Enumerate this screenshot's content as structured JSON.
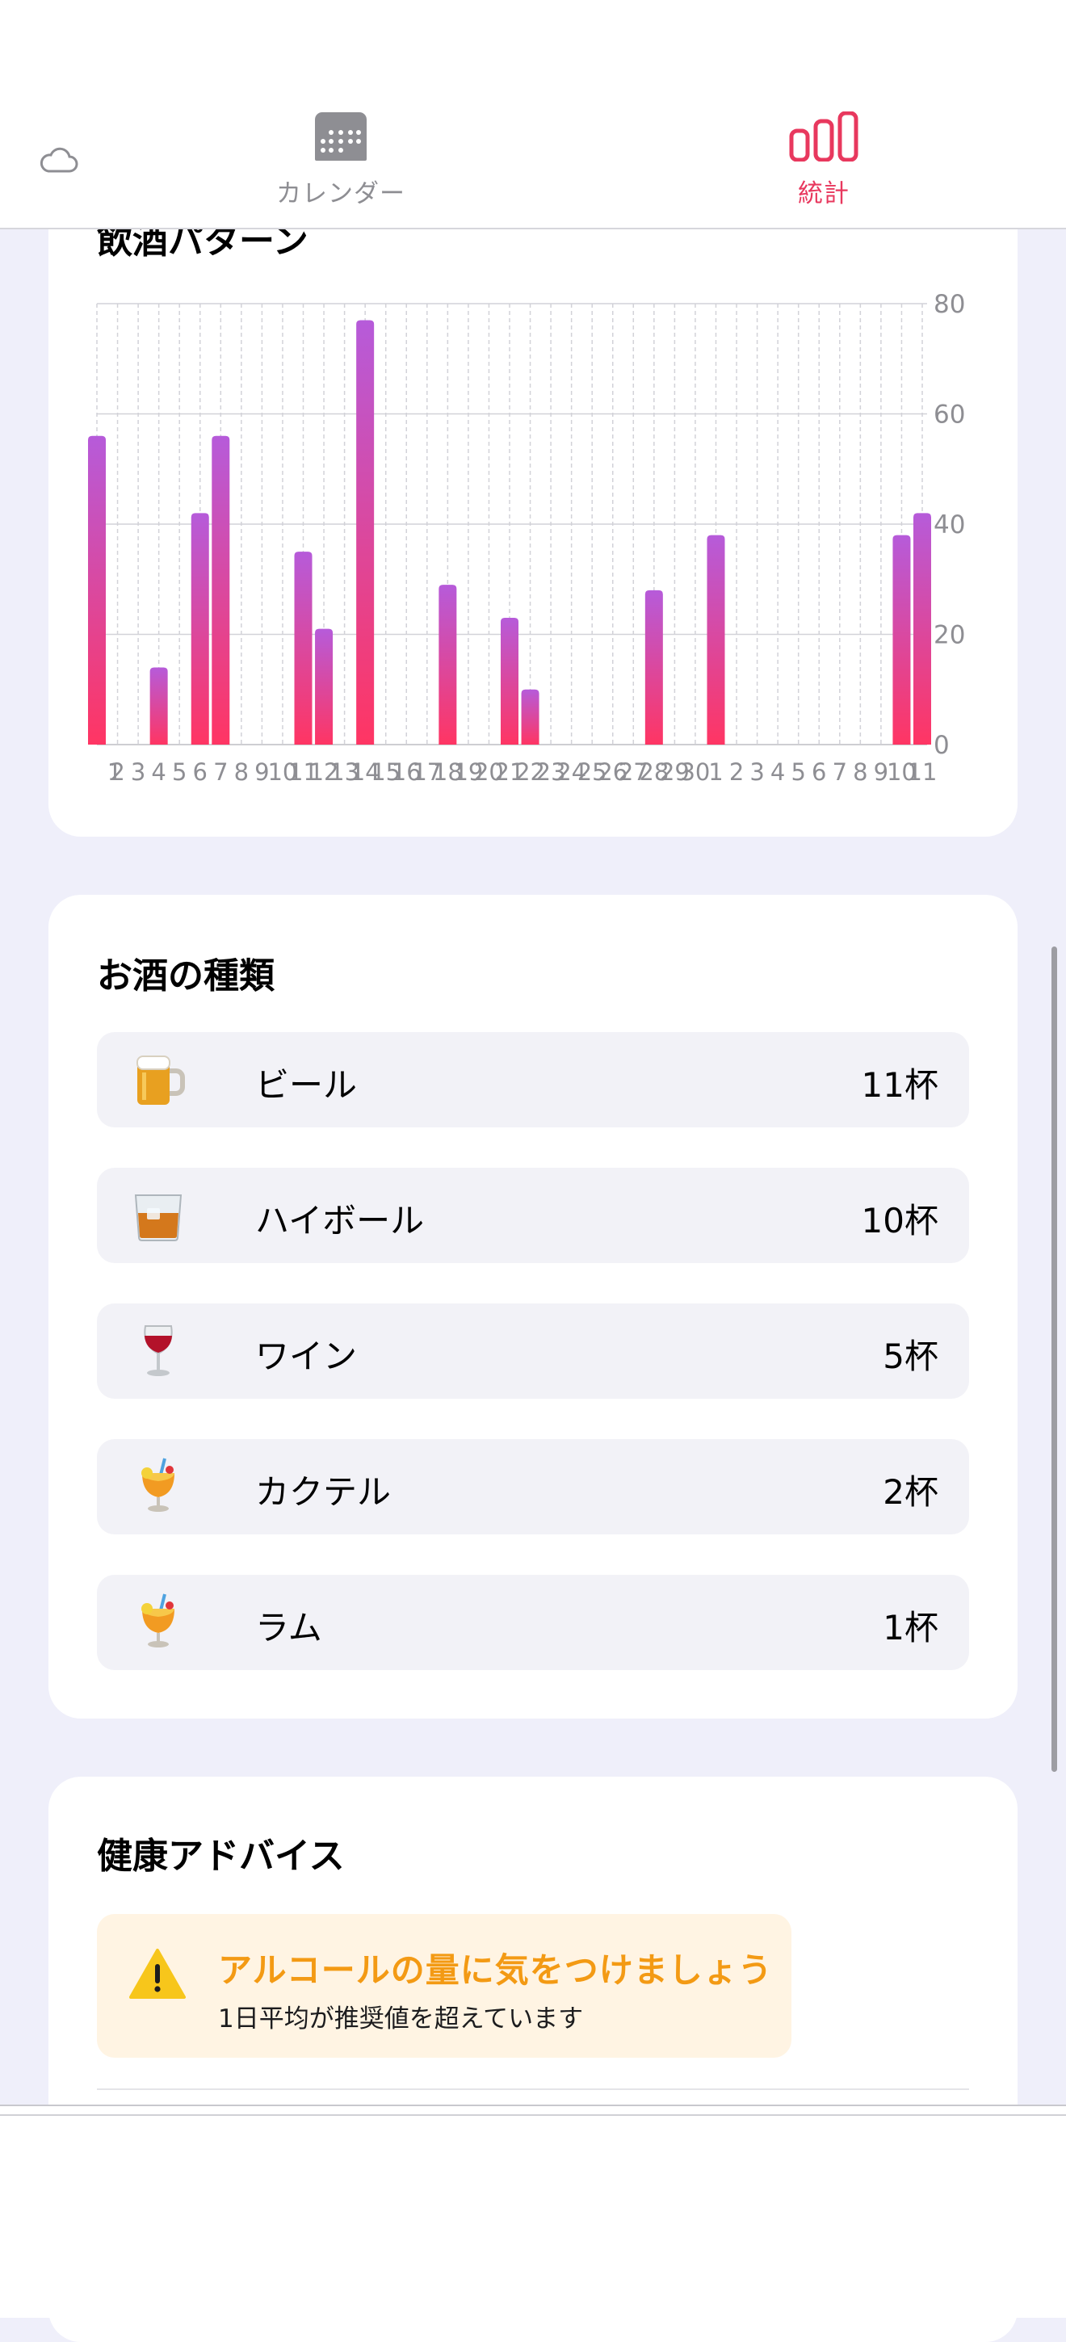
{
  "header": {
    "cloud_icon": "cloud-icon",
    "tabs": [
      {
        "label": "カレンダー",
        "icon": "calendar-icon",
        "selected": false
      },
      {
        "label": "統計",
        "icon": "bar-chart-icon",
        "selected": true
      }
    ]
  },
  "chart_card": {
    "title": "飲酒パターン"
  },
  "chart_data": {
    "type": "bar",
    "categories": [
      "1",
      "2",
      "3",
      "4",
      "5",
      "6",
      "7",
      "8",
      "9",
      "10",
      "11",
      "12",
      "13",
      "14",
      "15",
      "16",
      "17",
      "18",
      "19",
      "20",
      "21",
      "22",
      "23",
      "24",
      "25",
      "26",
      "27",
      "28",
      "29",
      "30",
      "1",
      "2",
      "3",
      "4",
      "5",
      "6",
      "7",
      "8",
      "9",
      "10",
      "11"
    ],
    "values": [
      56,
      0,
      0,
      14,
      0,
      42,
      56,
      0,
      0,
      0,
      35,
      21,
      0,
      77,
      0,
      0,
      0,
      29,
      0,
      0,
      23,
      10,
      0,
      0,
      0,
      0,
      0,
      28,
      0,
      0,
      38,
      0,
      0,
      0,
      0,
      0,
      0,
      0,
      0,
      38,
      42
    ],
    "ylim": [
      0,
      80
    ],
    "yticks": [
      0,
      20,
      40,
      60,
      80
    ],
    "xlabel": "",
    "ylabel": "",
    "grid": true,
    "colors": {
      "bar_top": "#B65BDA",
      "bar_bottom": "#FF3563"
    }
  },
  "types_card": {
    "title": "お酒の種類",
    "items": [
      {
        "icon": "beer-mug-icon",
        "name": "ビール",
        "count": "11杯"
      },
      {
        "icon": "tumbler-glass-icon",
        "name": "ハイボール",
        "count": "10杯"
      },
      {
        "icon": "wine-glass-icon",
        "name": "ワイン",
        "count": "5杯"
      },
      {
        "icon": "tropical-drink-icon",
        "name": "カクテル",
        "count": "2杯"
      },
      {
        "icon": "tropical-drink-icon",
        "name": "ラム",
        "count": "1杯"
      }
    ]
  },
  "advice_card": {
    "title": "健康アドバイス",
    "alert": {
      "icon": "warning-icon",
      "title": "アルコールの量に気をつけましょう",
      "subtitle": "1日平均が推奨値を超えています"
    }
  },
  "colors": {
    "accent": "#E8385E",
    "background": "#EFEFFA",
    "warning": "#F39A14"
  }
}
